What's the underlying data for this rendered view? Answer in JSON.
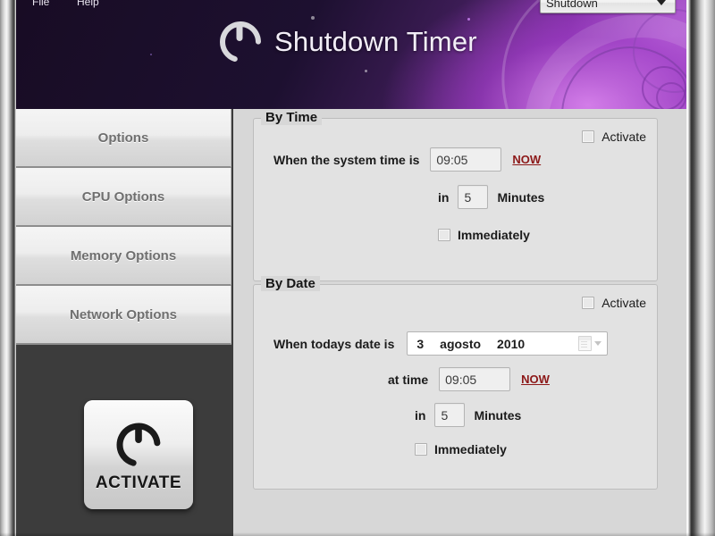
{
  "window": {
    "menu": {
      "file": "File",
      "help": "Help"
    }
  },
  "header": {
    "title": "Shutdown Timer",
    "power_icon": "power-icon",
    "mode_select": {
      "value": "Shutdown",
      "options": [
        "Shutdown"
      ],
      "caret_icon": "chevron-down-icon"
    },
    "background_color": "#190d26",
    "accent_color": "#b05fd0"
  },
  "sidebar": {
    "items": [
      {
        "label": "Options"
      },
      {
        "label": "CPU Options"
      },
      {
        "label": "Memory Options"
      },
      {
        "label": "Network Options"
      }
    ],
    "activate_button": {
      "label": "ACTIVATE",
      "icon": "power-icon"
    },
    "background_color": "#3c3c3c"
  },
  "main": {
    "by_time": {
      "title": "By Time",
      "activate_label": "Activate",
      "activate_checked": false,
      "system_time_label": "When the system time is",
      "system_time_value": "09:05",
      "now_label": "NOW",
      "in_label": "in",
      "minutes_value": "5",
      "minutes_label": "Minutes",
      "immediately_label": "Immediately",
      "immediately_checked": false
    },
    "by_date": {
      "title": "By Date",
      "activate_label": "Activate",
      "activate_checked": false,
      "date_label": "When todays date is",
      "date_day": "3",
      "date_month": "agosto",
      "date_year": "2010",
      "calendar_icon": "calendar-icon",
      "dropdown_icon": "chevron-down-icon",
      "at_time_label": "at time",
      "at_time_value": "09:05",
      "now_label": "NOW",
      "in_label": "in",
      "minutes_value": "5",
      "minutes_label": "Minutes",
      "immediately_label": "Immediately",
      "immediately_checked": false
    }
  },
  "colors": {
    "link_red": "#8c1818",
    "panel_bg": "#e2e2e2",
    "content_bg": "#d7d7d7"
  }
}
